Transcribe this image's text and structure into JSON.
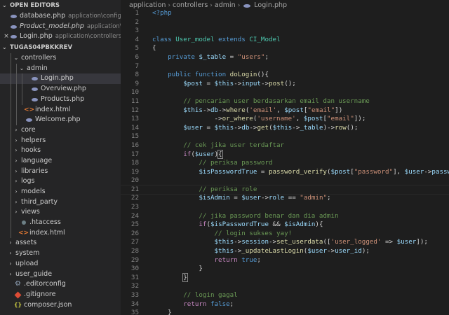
{
  "sidebar": {
    "open_editors_title": "OPEN EDITORS",
    "open_editors": [
      {
        "close": "",
        "name": "database.php",
        "path": "application\\config",
        "italic": false
      },
      {
        "close": "",
        "name": "Product_model.php",
        "path": "application\\m...",
        "italic": true
      },
      {
        "close": "×",
        "name": "Login.php",
        "path": "application\\controllers\\a...",
        "italic": false
      }
    ],
    "project_title": "TUGAS04PBKKREV",
    "tree": [
      {
        "depth": 1,
        "chev": "⌄",
        "icon": "",
        "name": "controllers"
      },
      {
        "depth": 2,
        "chev": "⌄",
        "icon": "",
        "name": "admin"
      },
      {
        "depth": 3,
        "chev": "",
        "icon": "php",
        "name": "Login.php",
        "active": true
      },
      {
        "depth": 3,
        "chev": "",
        "icon": "php",
        "name": "Overview.php"
      },
      {
        "depth": 3,
        "chev": "",
        "icon": "php",
        "name": "Products.php"
      },
      {
        "depth": 2,
        "chev": "",
        "icon": "html",
        "name": "index.html"
      },
      {
        "depth": 2,
        "chev": "",
        "icon": "php",
        "name": "Welcome.php"
      },
      {
        "depth": 1,
        "chev": "›",
        "icon": "",
        "name": "core"
      },
      {
        "depth": 1,
        "chev": "›",
        "icon": "",
        "name": "helpers"
      },
      {
        "depth": 1,
        "chev": "›",
        "icon": "",
        "name": "hooks"
      },
      {
        "depth": 1,
        "chev": "›",
        "icon": "",
        "name": "language"
      },
      {
        "depth": 1,
        "chev": "›",
        "icon": "",
        "name": "libraries"
      },
      {
        "depth": 1,
        "chev": "›",
        "icon": "",
        "name": "logs"
      },
      {
        "depth": 1,
        "chev": "›",
        "icon": "",
        "name": "models"
      },
      {
        "depth": 1,
        "chev": "›",
        "icon": "",
        "name": "third_party"
      },
      {
        "depth": 1,
        "chev": "›",
        "icon": "",
        "name": "views"
      },
      {
        "depth": 1,
        "chev": "",
        "icon": "hta",
        "name": ".htaccess"
      },
      {
        "depth": 1,
        "chev": "",
        "icon": "html",
        "name": "index.html"
      },
      {
        "depth": 0,
        "chev": "›",
        "icon": "",
        "name": "assets"
      },
      {
        "depth": 0,
        "chev": "›",
        "icon": "",
        "name": "system"
      },
      {
        "depth": 0,
        "chev": "›",
        "icon": "",
        "name": "upload"
      },
      {
        "depth": 0,
        "chev": "›",
        "icon": "",
        "name": "user_guide"
      },
      {
        "depth": 0,
        "chev": "",
        "icon": "cfg",
        "name": ".editorconfig"
      },
      {
        "depth": 0,
        "chev": "",
        "icon": "git",
        "name": ".gitignore"
      },
      {
        "depth": 0,
        "chev": "",
        "icon": "json",
        "name": "composer.json"
      }
    ]
  },
  "breadcrumbs": [
    "application",
    "controllers",
    "admin",
    "Login.php"
  ],
  "editor": {
    "lines": [
      [
        [
          "k",
          "<?php"
        ]
      ],
      [],
      [],
      [
        [
          "k",
          "class "
        ],
        [
          "t",
          "User_model "
        ],
        [
          "k",
          "extends "
        ],
        [
          "t",
          "CI_Model"
        ]
      ],
      [
        [
          "p",
          "{"
        ]
      ],
      [
        [
          "p",
          "    "
        ],
        [
          "k",
          "private "
        ],
        [
          "v",
          "$_table"
        ],
        [
          "p",
          " = "
        ],
        [
          "s",
          "\"users\""
        ],
        [
          "p",
          ";"
        ]
      ],
      [],
      [
        [
          "p",
          "    "
        ],
        [
          "k",
          "public function "
        ],
        [
          "f",
          "doLogin"
        ],
        [
          "p",
          "(){"
        ]
      ],
      [
        [
          "p",
          "        "
        ],
        [
          "v",
          "$post"
        ],
        [
          "p",
          " = "
        ],
        [
          "v",
          "$this"
        ],
        [
          "p",
          "->"
        ],
        [
          "v",
          "input"
        ],
        [
          "p",
          "->"
        ],
        [
          "f",
          "post"
        ],
        [
          "p",
          "();"
        ]
      ],
      [],
      [
        [
          "p",
          "        "
        ],
        [
          "c",
          "// pencarian user berdasarkan email dan username"
        ]
      ],
      [
        [
          "p",
          "        "
        ],
        [
          "v",
          "$this"
        ],
        [
          "p",
          "->"
        ],
        [
          "v",
          "db"
        ],
        [
          "p",
          "->"
        ],
        [
          "f",
          "where"
        ],
        [
          "p",
          "("
        ],
        [
          "s",
          "'email'"
        ],
        [
          "p",
          ", "
        ],
        [
          "v",
          "$post"
        ],
        [
          "p",
          "["
        ],
        [
          "s",
          "\"email\""
        ],
        [
          "p",
          "])"
        ]
      ],
      [
        [
          "p",
          "                ->"
        ],
        [
          "f",
          "or_where"
        ],
        [
          "p",
          "("
        ],
        [
          "s",
          "'username'"
        ],
        [
          "p",
          ", "
        ],
        [
          "v",
          "$post"
        ],
        [
          "p",
          "["
        ],
        [
          "s",
          "\"email\""
        ],
        [
          "p",
          "]);"
        ]
      ],
      [
        [
          "p",
          "        "
        ],
        [
          "v",
          "$user"
        ],
        [
          "p",
          " = "
        ],
        [
          "v",
          "$this"
        ],
        [
          "p",
          "->"
        ],
        [
          "v",
          "db"
        ],
        [
          "p",
          "->"
        ],
        [
          "f",
          "get"
        ],
        [
          "p",
          "("
        ],
        [
          "v",
          "$this"
        ],
        [
          "p",
          "->"
        ],
        [
          "v",
          "_table"
        ],
        [
          "p",
          ")->"
        ],
        [
          "f",
          "row"
        ],
        [
          "p",
          "();"
        ]
      ],
      [],
      [
        [
          "p",
          "        "
        ],
        [
          "c",
          "// cek jika user terdaftar"
        ]
      ],
      [
        [
          "p",
          "        "
        ],
        [
          "kc",
          "if"
        ],
        [
          "p",
          "("
        ],
        [
          "v",
          "$user"
        ],
        [
          "p",
          ")"
        ],
        [
          "bm",
          "{"
        ]
      ],
      [
        [
          "p",
          "            "
        ],
        [
          "c",
          "// periksa password"
        ]
      ],
      [
        [
          "p",
          "            "
        ],
        [
          "v",
          "$isPasswordTrue"
        ],
        [
          "p",
          " = "
        ],
        [
          "f",
          "password_verify"
        ],
        [
          "p",
          "("
        ],
        [
          "v",
          "$post"
        ],
        [
          "p",
          "["
        ],
        [
          "s",
          "\"password\""
        ],
        [
          "p",
          "], "
        ],
        [
          "v",
          "$user"
        ],
        [
          "p",
          "->"
        ],
        [
          "v",
          "password"
        ],
        [
          "p",
          ");"
        ]
      ],
      [],
      [
        [
          "p",
          "            "
        ],
        [
          "c",
          "// periksa role"
        ]
      ],
      [
        [
          "p",
          "            "
        ],
        [
          "v",
          "$isAdmin"
        ],
        [
          "p",
          " = "
        ],
        [
          "v",
          "$user"
        ],
        [
          "p",
          "->"
        ],
        [
          "v",
          "role"
        ],
        [
          "p",
          " == "
        ],
        [
          "s",
          "\"admin\""
        ],
        [
          "p",
          ";"
        ]
      ],
      [],
      [
        [
          "p",
          "            "
        ],
        [
          "c",
          "// jika password benar dan dia admin"
        ]
      ],
      [
        [
          "p",
          "            "
        ],
        [
          "kc",
          "if"
        ],
        [
          "p",
          "("
        ],
        [
          "v",
          "$isPasswordTrue"
        ],
        [
          "p",
          " && "
        ],
        [
          "v",
          "$isAdmin"
        ],
        [
          "p",
          "){"
        ]
      ],
      [
        [
          "p",
          "                "
        ],
        [
          "c",
          "// login sukses yay!"
        ]
      ],
      [
        [
          "p",
          "                "
        ],
        [
          "v",
          "$this"
        ],
        [
          "p",
          "->"
        ],
        [
          "v",
          "session"
        ],
        [
          "p",
          "->"
        ],
        [
          "f",
          "set_userdata"
        ],
        [
          "p",
          "(["
        ],
        [
          "s",
          "'user_logged'"
        ],
        [
          "p",
          " => "
        ],
        [
          "v",
          "$user"
        ],
        [
          "p",
          "]);"
        ]
      ],
      [
        [
          "p",
          "                "
        ],
        [
          "v",
          "$this"
        ],
        [
          "p",
          "->"
        ],
        [
          "f",
          "_updateLastLogin"
        ],
        [
          "p",
          "("
        ],
        [
          "v",
          "$user"
        ],
        [
          "p",
          "->"
        ],
        [
          "v",
          "user_id"
        ],
        [
          "p",
          ");"
        ]
      ],
      [
        [
          "p",
          "                "
        ],
        [
          "kc",
          "return "
        ],
        [
          "k",
          "true"
        ],
        [
          "p",
          ";"
        ]
      ],
      [
        [
          "p",
          "            }"
        ]
      ],
      [
        [
          "p",
          "        "
        ],
        [
          "bm",
          "}"
        ]
      ],
      [],
      [
        [
          "p",
          "        "
        ],
        [
          "c",
          "// login gagal"
        ]
      ],
      [
        [
          "p",
          "        "
        ],
        [
          "kc",
          "return "
        ],
        [
          "k",
          "false"
        ],
        [
          "p",
          ";"
        ]
      ],
      [
        [
          "p",
          "    }"
        ]
      ]
    ],
    "current_line": 21
  }
}
